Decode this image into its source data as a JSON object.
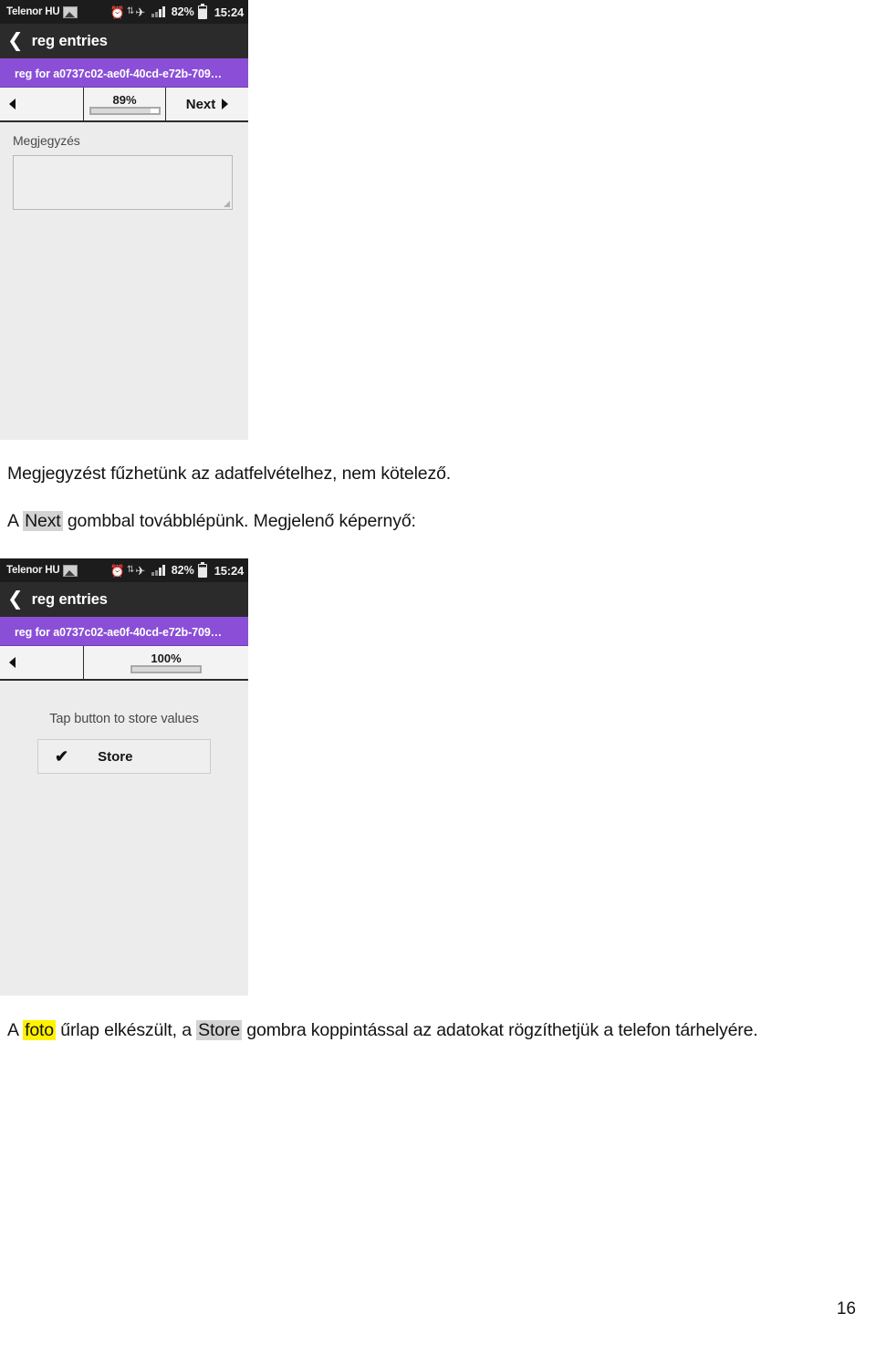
{
  "document": {
    "page_number": "16",
    "paragraphs": {
      "line1": "Megjegyzést fűzhetünk az adatfelvételhez, nem kötelező.",
      "line2_before": "A ",
      "line2_highlight": "Next",
      "line2_after": " gombbal továbblépünk. Megjelenő képernyő:",
      "line3_a": "A ",
      "line3_highlight_yellow": "foto",
      "line3_b": " űrlap elkészült, a ",
      "line3_highlight_grey": "Store",
      "line3_c": " gombra koppintással az adatokat rögzíthetjük a telefon tárhelyére."
    },
    "highlight_colors": {
      "grey": "#d3d3d3",
      "yellow": "#fff200"
    }
  },
  "screenshot_1": {
    "status_bar": {
      "carrier": "Telenor HU",
      "image_icon": "picture-icon",
      "alarm_icon": "alarm-clock-icon",
      "sync_icon": "sync-icon",
      "wifi_icon": "wifi-icon",
      "signal_icon": "signal-bars-icon",
      "battery_percent": "82%",
      "battery_icon": "battery-icon",
      "time": "15:24"
    },
    "action_bar": {
      "back_icon": "back-chevron-icon",
      "title": "reg entries"
    },
    "form_title": "reg for a0737c02-ae0f-40cd-e72b-709…",
    "accent_color": "#8a4fd6",
    "nav": {
      "prev_icon": "triangle-left-icon",
      "progress_percent": "89%",
      "progress_value": 89,
      "next_label": "Next",
      "next_icon": "triangle-right-icon"
    },
    "body": {
      "field_label": "Megjegyzés",
      "note_value": "",
      "note_placeholder": ""
    }
  },
  "screenshot_2": {
    "status_bar": {
      "carrier": "Telenor HU",
      "image_icon": "picture-icon",
      "alarm_icon": "alarm-clock-icon",
      "sync_icon": "sync-icon",
      "wifi_icon": "wifi-icon",
      "signal_icon": "signal-bars-icon",
      "battery_percent": "82%",
      "battery_icon": "battery-icon",
      "time": "15:24"
    },
    "action_bar": {
      "back_icon": "back-chevron-icon",
      "title": "reg entries"
    },
    "form_title": "reg for a0737c02-ae0f-40cd-e72b-709…",
    "accent_color": "#8a4fd6",
    "nav": {
      "prev_icon": "triangle-left-icon",
      "progress_percent": "100%",
      "progress_value": 100
    },
    "body": {
      "hint": "Tap button to store values",
      "store_icon": "check-mark-icon",
      "store_label": "Store"
    }
  }
}
